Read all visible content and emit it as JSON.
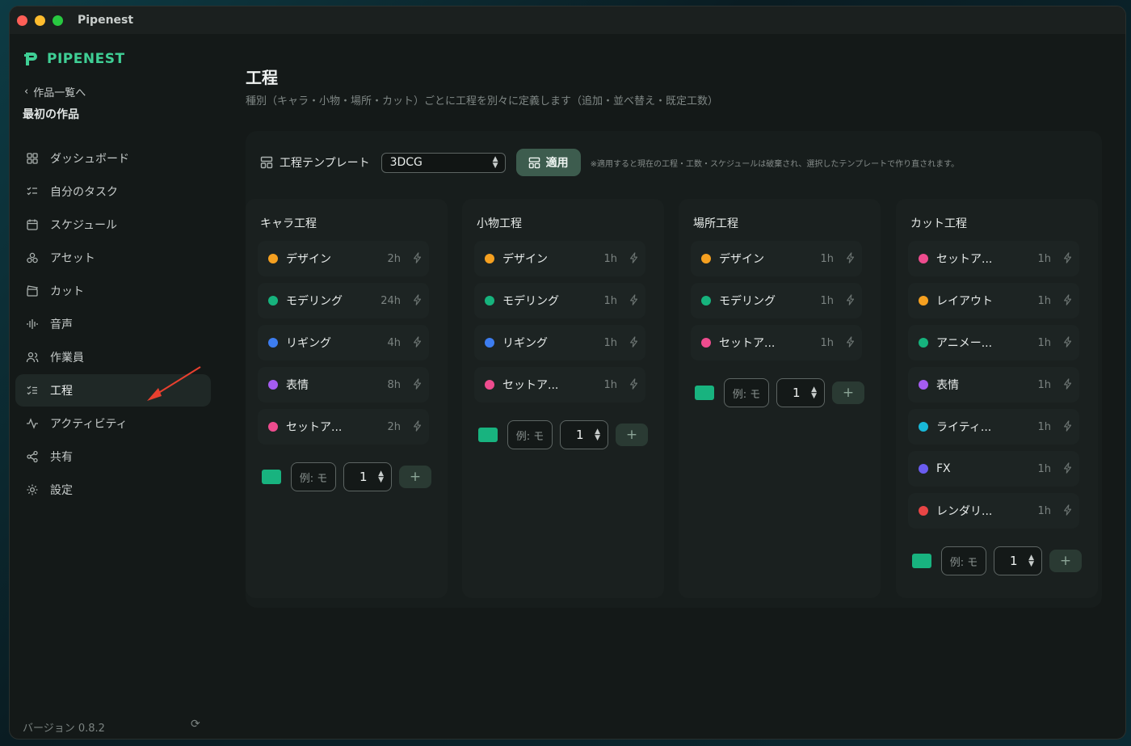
{
  "window": {
    "title": "Pipenest"
  },
  "sidebar": {
    "brand": "PIPENEST",
    "back_link": "作品一覧へ",
    "project": "最初の作品",
    "items": [
      {
        "label": "ダッシュボード",
        "icon": "dashboard-icon"
      },
      {
        "label": "自分のタスク",
        "icon": "task-list-icon"
      },
      {
        "label": "スケジュール",
        "icon": "calendar-icon"
      },
      {
        "label": "アセット",
        "icon": "assets-icon"
      },
      {
        "label": "カット",
        "icon": "clapper-icon"
      },
      {
        "label": "音声",
        "icon": "audio-wave-icon"
      },
      {
        "label": "作業員",
        "icon": "users-icon"
      },
      {
        "label": "工程",
        "icon": "checklist-icon",
        "active": true
      },
      {
        "label": "アクティビティ",
        "icon": "activity-icon"
      },
      {
        "label": "共有",
        "icon": "share-icon"
      },
      {
        "label": "設定",
        "icon": "gear-icon"
      }
    ],
    "version": "バージョン 0.8.2"
  },
  "main": {
    "title": "工程",
    "description": "種別（キャラ・小物・場所・カット）ごとに工程を別々に定義します（追加・並べ替え・既定工数）",
    "template": {
      "label": "工程テンプレート",
      "selected": "3DCG",
      "apply_label": "適用",
      "note": "※適用すると現在の工程・工数・スケジュールは破棄され、選択したテンプレートで作り直されます。"
    },
    "add_form": {
      "placeholder": "例: モ",
      "hours": "1",
      "plus": "+",
      "swatch_color": "#18b37f"
    },
    "columns": [
      {
        "title": "キャラ工程",
        "processes": [
          {
            "name": "デザイン",
            "hours": "2h",
            "color": "#f5a020"
          },
          {
            "name": "モデリング",
            "hours": "24h",
            "color": "#16b37d"
          },
          {
            "name": "リギング",
            "hours": "4h",
            "color": "#3d7df0"
          },
          {
            "name": "表情",
            "hours": "8h",
            "color": "#a55cf0"
          },
          {
            "name": "セットア...",
            "hours": "2h",
            "color": "#ee4c8e"
          }
        ]
      },
      {
        "title": "小物工程",
        "processes": [
          {
            "name": "デザイン",
            "hours": "1h",
            "color": "#f5a020"
          },
          {
            "name": "モデリング",
            "hours": "1h",
            "color": "#16b37d"
          },
          {
            "name": "リギング",
            "hours": "1h",
            "color": "#3d7df0"
          },
          {
            "name": "セットア...",
            "hours": "1h",
            "color": "#ee4c8e"
          }
        ]
      },
      {
        "title": "場所工程",
        "processes": [
          {
            "name": "デザイン",
            "hours": "1h",
            "color": "#f5a020"
          },
          {
            "name": "モデリング",
            "hours": "1h",
            "color": "#16b37d"
          },
          {
            "name": "セットア...",
            "hours": "1h",
            "color": "#ee4c8e"
          }
        ]
      },
      {
        "title": "カット工程",
        "processes": [
          {
            "name": "セットア...",
            "hours": "1h",
            "color": "#ee4c8e"
          },
          {
            "name": "レイアウト",
            "hours": "1h",
            "color": "#f5a020"
          },
          {
            "name": "アニメー...",
            "hours": "1h",
            "color": "#16b37d"
          },
          {
            "name": "表情",
            "hours": "1h",
            "color": "#a55cf0"
          },
          {
            "name": "ライティ...",
            "hours": "1h",
            "color": "#18b8d8"
          },
          {
            "name": "FX",
            "hours": "1h",
            "color": "#6a5cf0"
          },
          {
            "name": "レンダリ...",
            "hours": "1h",
            "color": "#e84545"
          }
        ]
      }
    ]
  }
}
